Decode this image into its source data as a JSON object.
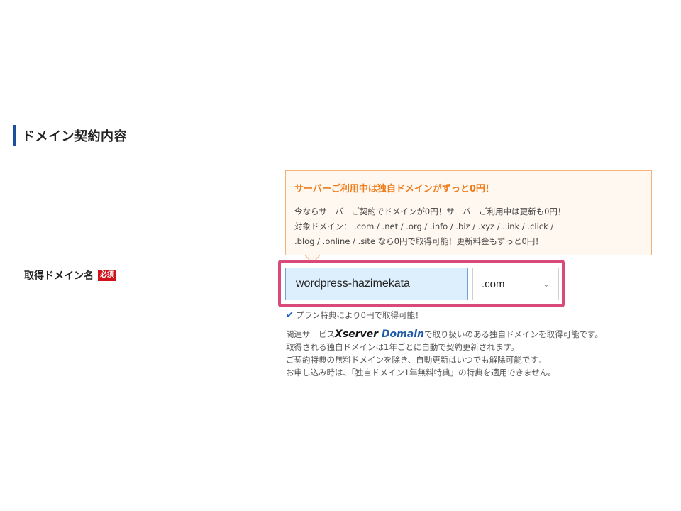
{
  "section": {
    "title": "ドメイン契約内容"
  },
  "field": {
    "label": "取得ドメイン名",
    "required_badge": "必須"
  },
  "promo": {
    "title": "サーバーご利用中は独自ドメインがずっと0円！",
    "lines": [
      "今ならサーバーご契約でドメインが0円！サーバーご利用中は更新も0円！",
      "対象ドメイン： .com / .net / .org / .info / .biz / .xyz / .link / .click /",
      ".blog / .online / .site なら0円で取得可能！更新料金もずっと0円！"
    ]
  },
  "domain_input": {
    "value": "wordpress-hazimekata"
  },
  "tld_select": {
    "selected": ".com"
  },
  "check_text": "プラン特典により0円で取得可能！",
  "notes": {
    "line1_prefix": "関連サービス",
    "brand_x": "Xserver",
    "brand_d": "Domain",
    "line1_suffix": "で取り扱いのある独自ドメインを取得可能です。",
    "line2": "取得される独自ドメインは1年ごとに自動で契約更新されます。",
    "line3": "ご契約特典の無料ドメインを除き、自動更新はいつでも解除可能です。",
    "line4": "お申し込み時は、「独自ドメイン1年無料特典」の特典を適用できません。"
  },
  "icons": {
    "check": "check-icon",
    "chevron": "chevron-down-icon"
  },
  "colors": {
    "accent_bar": "#1d4f9c",
    "promo_title": "#f07c1c",
    "highlight": "#d9497a",
    "required": "#d0121b"
  }
}
